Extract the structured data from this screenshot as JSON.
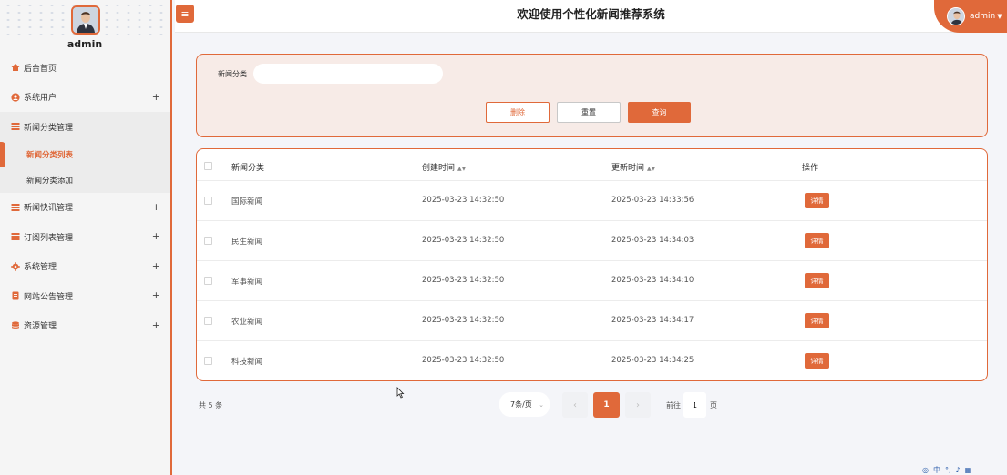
{
  "app": {
    "title": "欢迎使用个性化新闻推荐系统",
    "user": "admin"
  },
  "sidebar": {
    "username": "admin",
    "items": [
      {
        "label": "后台首页",
        "icon": "home-icon",
        "expand": ""
      },
      {
        "label": "系统用户",
        "icon": "user-icon",
        "expand": "+"
      },
      {
        "label": "新闻分类管理",
        "icon": "grid-icon",
        "expand": "−",
        "children": [
          {
            "label": "新闻分类列表"
          },
          {
            "label": "新闻分类添加"
          }
        ]
      },
      {
        "label": "新闻快讯管理",
        "icon": "grid-icon",
        "expand": "+"
      },
      {
        "label": "订阅列表管理",
        "icon": "grid-icon",
        "expand": "+"
      },
      {
        "label": "系统管理",
        "icon": "gear-icon",
        "expand": "+"
      },
      {
        "label": "网站公告管理",
        "icon": "document-icon",
        "expand": "+"
      },
      {
        "label": "资源管理",
        "icon": "database-icon",
        "expand": "+"
      }
    ]
  },
  "search": {
    "label": "新闻分类",
    "value": "",
    "placeholder": ""
  },
  "buttons": {
    "delete": "删除",
    "reset": "重置",
    "query": "查询"
  },
  "table": {
    "headers": [
      "新闻分类",
      "创建时间",
      "更新时间",
      "操作"
    ],
    "rows": [
      {
        "category": "国际新闻",
        "created": "2025-03-23 14:32:50",
        "updated": "2025-03-23 14:33:56",
        "action": "详情"
      },
      {
        "category": "民生新闻",
        "created": "2025-03-23 14:32:50",
        "updated": "2025-03-23 14:34:03",
        "action": "详情"
      },
      {
        "category": "军事新闻",
        "created": "2025-03-23 14:32:50",
        "updated": "2025-03-23 14:34:10",
        "action": "详情"
      },
      {
        "category": "农业新闻",
        "created": "2025-03-23 14:32:50",
        "updated": "2025-03-23 14:34:17",
        "action": "详情"
      },
      {
        "category": "科技新闻",
        "created": "2025-03-23 14:32:50",
        "updated": "2025-03-23 14:34:25",
        "action": "详情"
      }
    ]
  },
  "pagination": {
    "total": "共 5 条",
    "page_size": "7条/页",
    "current": "1",
    "goto_label": "前往",
    "goto_value": "1",
    "goto_unit": "页"
  },
  "colors": {
    "accent": "#e0693a",
    "panel_bg": "#f7ebe7",
    "page_bg": "#f4f5f9"
  },
  "tray": {
    "lang": "中"
  }
}
